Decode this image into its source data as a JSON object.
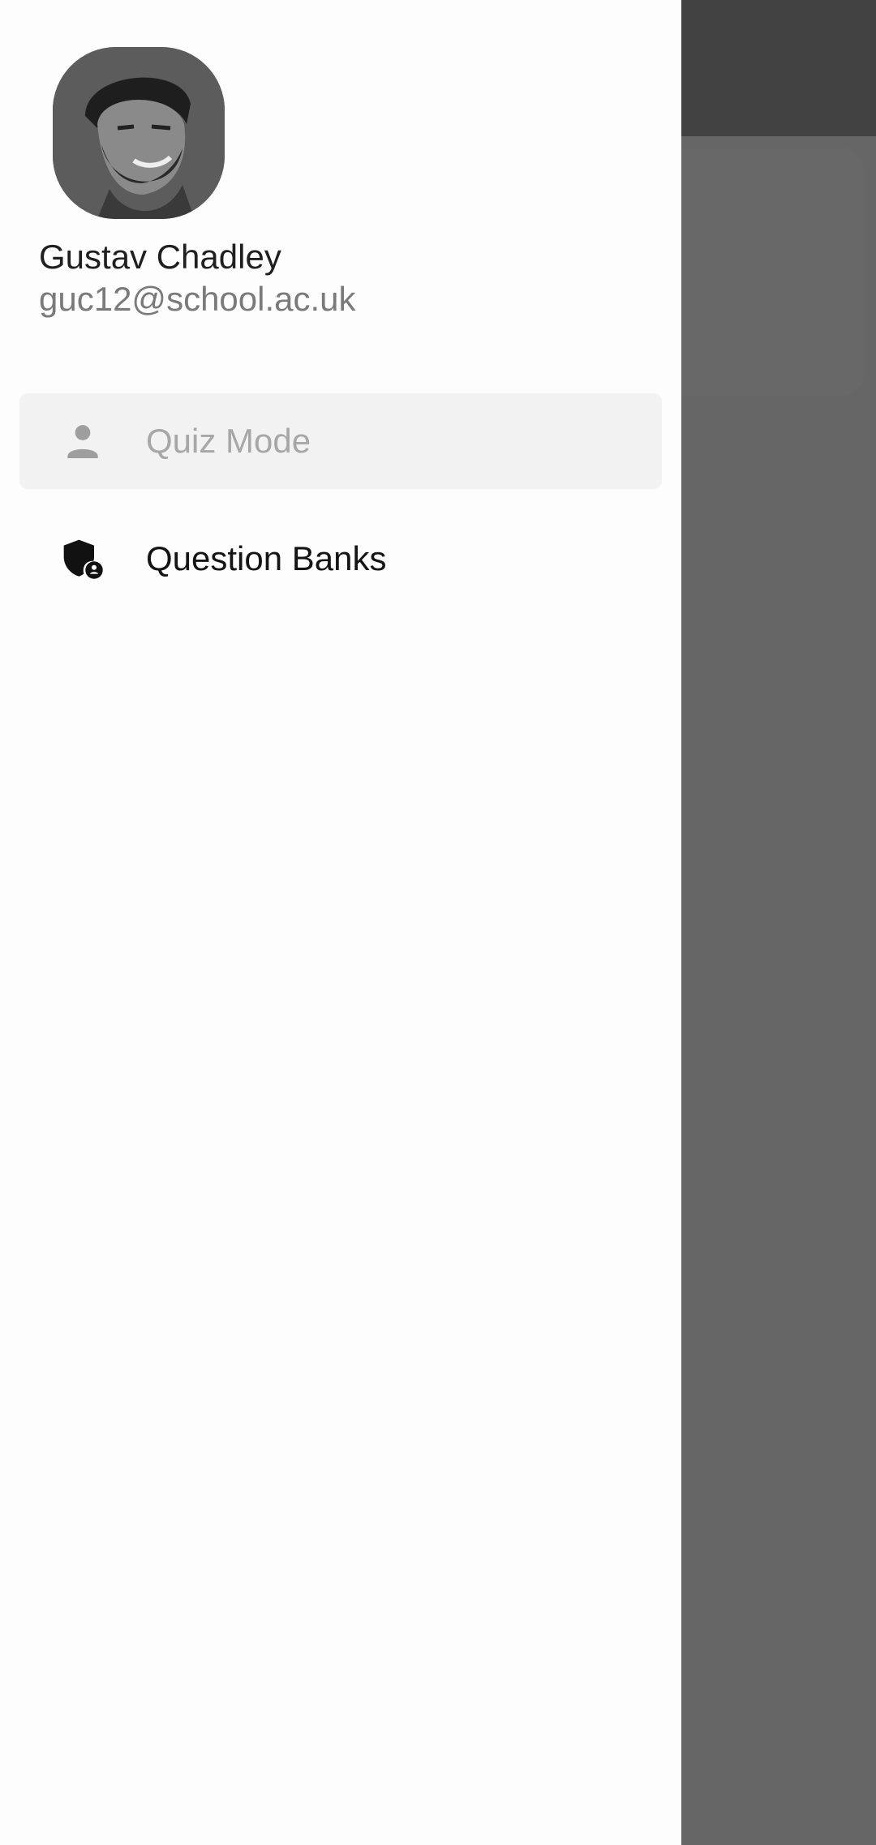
{
  "user": {
    "name": "Gustav Chadley",
    "email": "guc12@school.ac.uk"
  },
  "menu": {
    "items": [
      {
        "label": "Quiz Mode",
        "icon": "person-icon",
        "selected": true
      },
      {
        "label": "Question Banks",
        "icon": "shield-person-icon",
        "selected": false
      }
    ]
  },
  "colors": {
    "drawer_bg": "#fdfdfd",
    "scrim": "#666666",
    "selected_item_bg": "#f2f2f2",
    "selected_item_text": "#a7a7a7"
  }
}
